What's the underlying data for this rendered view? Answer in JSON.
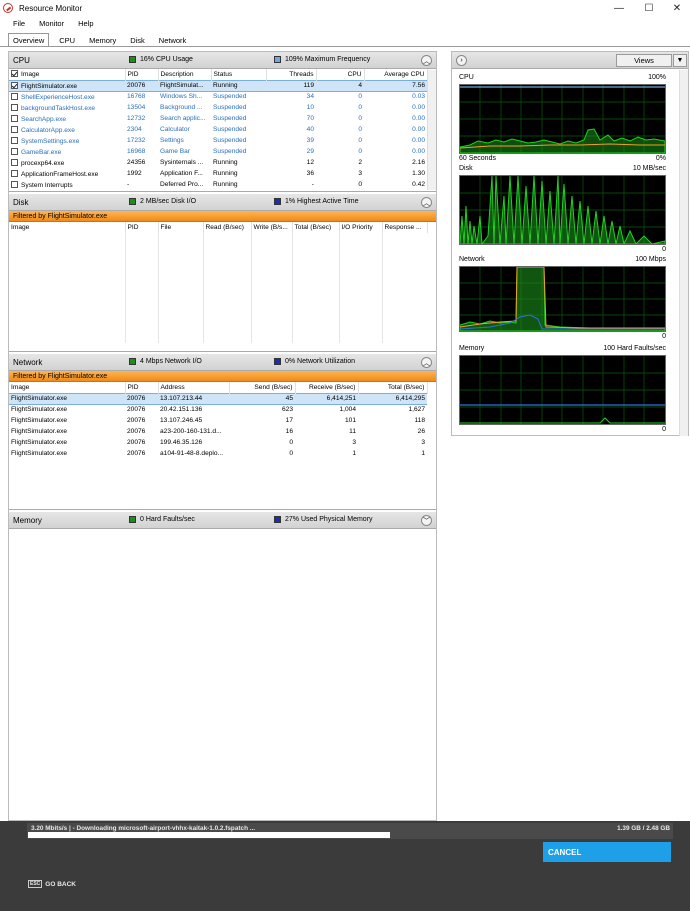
{
  "window": {
    "title": "Resource Monitor",
    "controls": {
      "minimize": "—",
      "maximize": "☐",
      "close": "✕"
    }
  },
  "menu": [
    "File",
    "Monitor",
    "Help"
  ],
  "tabs": [
    {
      "label": "Overview",
      "active": true
    },
    {
      "label": "CPU",
      "active": false
    },
    {
      "label": "Memory",
      "active": false
    },
    {
      "label": "Disk",
      "active": false
    },
    {
      "label": "Network",
      "active": false
    }
  ],
  "cpu": {
    "title": "CPU",
    "indicator1": "16% CPU Usage",
    "indicator2": "109% Maximum Frequency",
    "columns": [
      "Image",
      "PID",
      "Description",
      "Status",
      "Threads",
      "CPU",
      "Average CPU"
    ],
    "rows": [
      {
        "checked": true,
        "image": "FlightSimulator.exe",
        "pid": "20076",
        "description": "FlightSimulat...",
        "status": "Running",
        "threads": "119",
        "cpu": "4",
        "avg": "7.56",
        "suspended": false,
        "selected": true
      },
      {
        "checked": false,
        "image": "ShellExperienceHost.exe",
        "pid": "16768",
        "description": "Windows Sh...",
        "status": "Suspended",
        "threads": "34",
        "cpu": "0",
        "avg": "0.03",
        "suspended": true
      },
      {
        "checked": false,
        "image": "backgroundTaskHost.exe",
        "pid": "13504",
        "description": "Background ...",
        "status": "Suspended",
        "threads": "10",
        "cpu": "0",
        "avg": "0.00",
        "suspended": true
      },
      {
        "checked": false,
        "image": "SearchApp.exe",
        "pid": "12732",
        "description": "Search applic...",
        "status": "Suspended",
        "threads": "70",
        "cpu": "0",
        "avg": "0.00",
        "suspended": true
      },
      {
        "checked": false,
        "image": "CalculatorApp.exe",
        "pid": "2304",
        "description": "Calculator",
        "status": "Suspended",
        "threads": "40",
        "cpu": "0",
        "avg": "0.00",
        "suspended": true
      },
      {
        "checked": false,
        "image": "SystemSettings.exe",
        "pid": "17232",
        "description": "Settings",
        "status": "Suspended",
        "threads": "39",
        "cpu": "0",
        "avg": "0.00",
        "suspended": true
      },
      {
        "checked": false,
        "image": "GameBar.exe",
        "pid": "16968",
        "description": "Game Bar",
        "status": "Suspended",
        "threads": "29",
        "cpu": "0",
        "avg": "0.00",
        "suspended": true
      },
      {
        "checked": false,
        "image": "procexp64.exe",
        "pid": "24356",
        "description": "Sysinternals ...",
        "status": "Running",
        "threads": "12",
        "cpu": "2",
        "avg": "2.16",
        "suspended": false
      },
      {
        "checked": false,
        "image": "ApplicationFrameHost.exe",
        "pid": "1992",
        "description": "Application F...",
        "status": "Running",
        "threads": "36",
        "cpu": "3",
        "avg": "1.30",
        "suspended": false
      },
      {
        "checked": false,
        "image": "System Interrupts",
        "pid": "-",
        "description": "Deferred Pro...",
        "status": "Running",
        "threads": "-",
        "cpu": "0",
        "avg": "0.42",
        "suspended": false
      }
    ]
  },
  "disk": {
    "title": "Disk",
    "indicator1": "2 MB/sec Disk I/O",
    "indicator2": "1% Highest Active Time",
    "filter": "Filtered by FlightSimulator.exe",
    "columns": [
      "Image",
      "PID",
      "File",
      "Read (B/sec)",
      "Write (B/s...",
      "Total (B/sec)",
      "I/O Priority",
      "Response ..."
    ]
  },
  "network": {
    "title": "Network",
    "indicator1": "4 Mbps Network I/O",
    "indicator2": "0% Network Utilization",
    "filter": "Filtered by FlightSimulator.exe",
    "columns": [
      "Image",
      "PID",
      "Address",
      "Send (B/sec)",
      "Receive (B/sec)",
      "Total (B/sec)"
    ],
    "rows": [
      {
        "image": "FlightSimulator.exe",
        "pid": "20076",
        "address": "13.107.213.44",
        "send": "45",
        "receive": "6,414,251",
        "total": "6,414,295",
        "selected": true
      },
      {
        "image": "FlightSimulator.exe",
        "pid": "20076",
        "address": "20.42.151.136",
        "send": "623",
        "receive": "1,004",
        "total": "1,627"
      },
      {
        "image": "FlightSimulator.exe",
        "pid": "20076",
        "address": "13.107.246.45",
        "send": "17",
        "receive": "101",
        "total": "118"
      },
      {
        "image": "FlightSimulator.exe",
        "pid": "20076",
        "address": "a23-200-160-131.d...",
        "send": "16",
        "receive": "11",
        "total": "26"
      },
      {
        "image": "FlightSimulator.exe",
        "pid": "20076",
        "address": "199.46.35.126",
        "send": "0",
        "receive": "3",
        "total": "3"
      },
      {
        "image": "FlightSimulator.exe",
        "pid": "20076",
        "address": "a104-91-48-8.deplo...",
        "send": "0",
        "receive": "1",
        "total": "1"
      }
    ]
  },
  "memory": {
    "title": "Memory",
    "indicator1": "0 Hard Faults/sec",
    "indicator2": "27% Used Physical Memory"
  },
  "graphs": {
    "views_label": "Views",
    "cpu": {
      "title": "CPU",
      "max": "100%",
      "footer_left": "60 Seconds",
      "footer_right": "0%"
    },
    "disk": {
      "title": "Disk",
      "max": "10 MB/sec",
      "footer_right": "0"
    },
    "network": {
      "title": "Network",
      "max": "100 Mbps",
      "footer_right": "0"
    },
    "memory": {
      "title": "Memory",
      "max": "100 Hard Faults/sec",
      "footer_right": "0"
    },
    "colors": {
      "green": "#1fd21f",
      "orange": "#f0a020",
      "blue": "#2f6fe0",
      "grid": "#0a5a0a"
    }
  },
  "download": {
    "status_text": "3.20 Mbits/s | - Downloading microsoft-airport-vhhx-kaitak-1.0.2.fspatch ...",
    "size_text": "1.39 GB / 2.48 GB",
    "progress": 0.56,
    "cancel_label": "CANCEL",
    "esc_key": "ESC",
    "back_label": "GO BACK"
  }
}
